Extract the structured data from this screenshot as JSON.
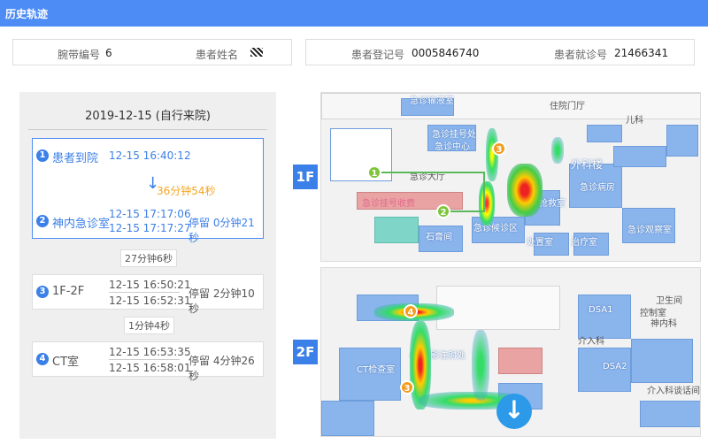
{
  "window": {
    "title": "历史轨迹"
  },
  "info": {
    "wristband_label": "腕带编号",
    "wristband_value": "6",
    "patient_name_label": "患者姓名",
    "reg_label": "患者登记号",
    "reg_value": "0005846740",
    "visit_label": "患者就诊号",
    "visit_value": "21466341"
  },
  "trajectory": {
    "date_header": "2019-12-15 (自行来院)",
    "items": [
      {
        "num": "1",
        "name": "患者到院",
        "time": "12-15 16:40:12",
        "interval": "36分钟54秒"
      },
      {
        "num": "2",
        "name": "神内急诊室",
        "time_in": "12-15 17:17:06",
        "time_out": "12-15 17:17:27",
        "stay": "停留 0分钟21秒"
      }
    ],
    "gap1": "27分钟6秒",
    "item3": {
      "num": "3",
      "name": "1F-2F",
      "time_in": "12-15 16:50:21",
      "time_out": "12-15 16:52:31",
      "stay": "停留 2分钟10秒"
    },
    "gap2": "1分钟4秒",
    "item4": {
      "num": "4",
      "name": "CT室",
      "time_in": "12-15 16:53:35",
      "time_out": "12-15 16:58:01",
      "stay": "停留 4分钟26秒"
    }
  },
  "maps": {
    "floor1": "1F",
    "floor2": "2F",
    "f1_labels": [
      "急诊输液室",
      "急诊挂号处",
      "住院门厅",
      "急诊中心",
      "外科楼",
      "急诊大厅",
      "急诊挂号收费",
      "急诊抢救室",
      "急诊病房",
      "石膏间",
      "急诊候诊区",
      "急诊观察室",
      "处置室",
      "治疗室",
      "儿科"
    ],
    "f2_labels": [
      "DSA1",
      "DSA2",
      "CT检查室",
      "CT造影注射处",
      "控制室",
      "介入科",
      "介入科谈话间",
      "卫生间",
      "神内科"
    ],
    "f1_markers": [
      "1",
      "2",
      "3"
    ],
    "f2_markers": [
      "4",
      "3"
    ]
  },
  "colors": {
    "accent": "#4d8cf5",
    "marker_green": "#7dc53b",
    "marker_orange": "#f39c1e"
  }
}
